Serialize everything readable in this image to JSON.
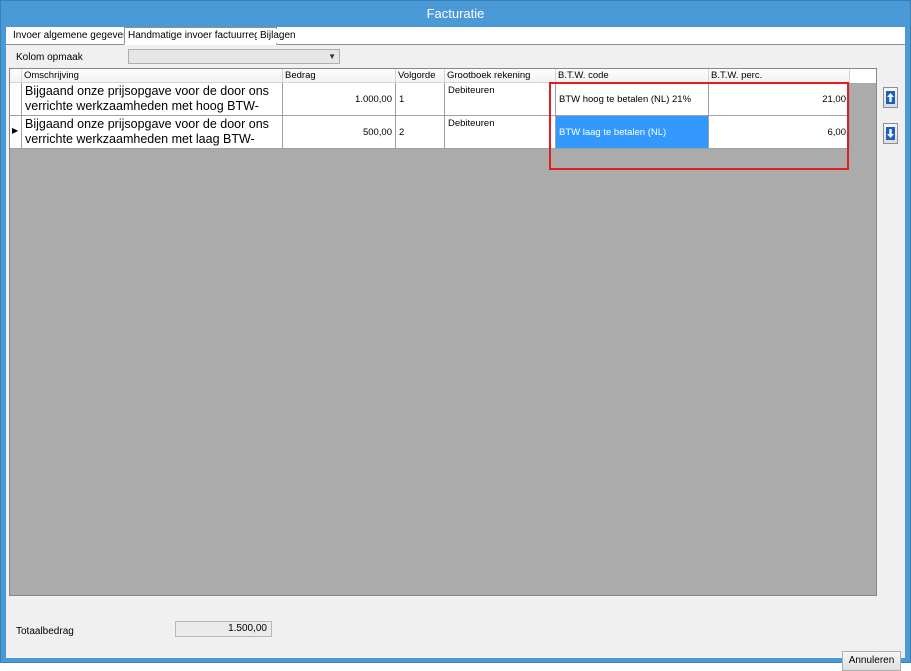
{
  "window": {
    "title": "Facturatie"
  },
  "tabs": [
    {
      "label": "Invoer algemene gegevens"
    },
    {
      "label": "Handmatige invoer factuurregels"
    },
    {
      "label": "Bijlagen"
    }
  ],
  "toolbar": {
    "kolom_label": "Kolom opmaak",
    "kolom_value": ""
  },
  "grid": {
    "columns": [
      "Omschrijving",
      "Bedrag",
      "Volgorde",
      "Grootboek rekening",
      "B.T.W. code",
      "B.T.W. perc."
    ],
    "rows": [
      {
        "omschrijving": "Bijgaand onze prijsopgave voor de door ons verrichte werkzaamheden met hoog BTW-tarief:",
        "bedrag": "1.000,00",
        "volgorde": "1",
        "grootboek": "Debiteuren",
        "btw_code": "BTW hoog te betalen (NL) 21%",
        "btw_perc": "21,00"
      },
      {
        "omschrijving": "Bijgaand onze prijsopgave voor de door ons verrichte werkzaamheden met laag BTW-tarief:",
        "bedrag": "500,00",
        "volgorde": "2",
        "grootboek": "Debiteuren",
        "btw_code": "BTW laag te betalen (NL)",
        "btw_perc": "6,00"
      }
    ]
  },
  "footer": {
    "totaal_label": "Totaalbedrag",
    "totaal_value": "1.500,00",
    "cancel_label": "Annuleren"
  },
  "colors": {
    "titlebar": "#4a9ad8",
    "selection": "#3399ff",
    "highlight": "#e02020"
  }
}
